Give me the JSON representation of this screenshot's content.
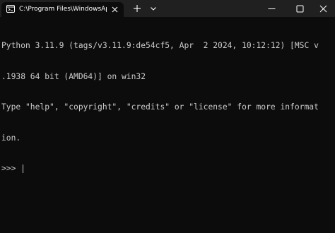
{
  "tab": {
    "title": "C:\\Program Files\\WindowsAp",
    "icon": "terminal-icon"
  },
  "toolbar": {
    "new_tab_icon": "plus-icon",
    "dropdown_icon": "chevron-down-icon"
  },
  "window_controls": {
    "minimize_icon": "minimize-icon",
    "maximize_icon": "maximize-icon",
    "close_icon": "close-icon"
  },
  "console": {
    "lines": [
      "Python 3.11.9 (tags/v3.11.9:de54cf5, Apr  2 2024, 10:12:12) [MSC v",
      ".1938 64 bit (AMD64)] on win32",
      "Type \"help\", \"copyright\", \"credits\" or \"license\" for more informat",
      "ion."
    ],
    "prompt": ">>> "
  },
  "colors": {
    "background": "#0c0c0c",
    "titlebar": "#202020",
    "text": "#cccccc"
  }
}
